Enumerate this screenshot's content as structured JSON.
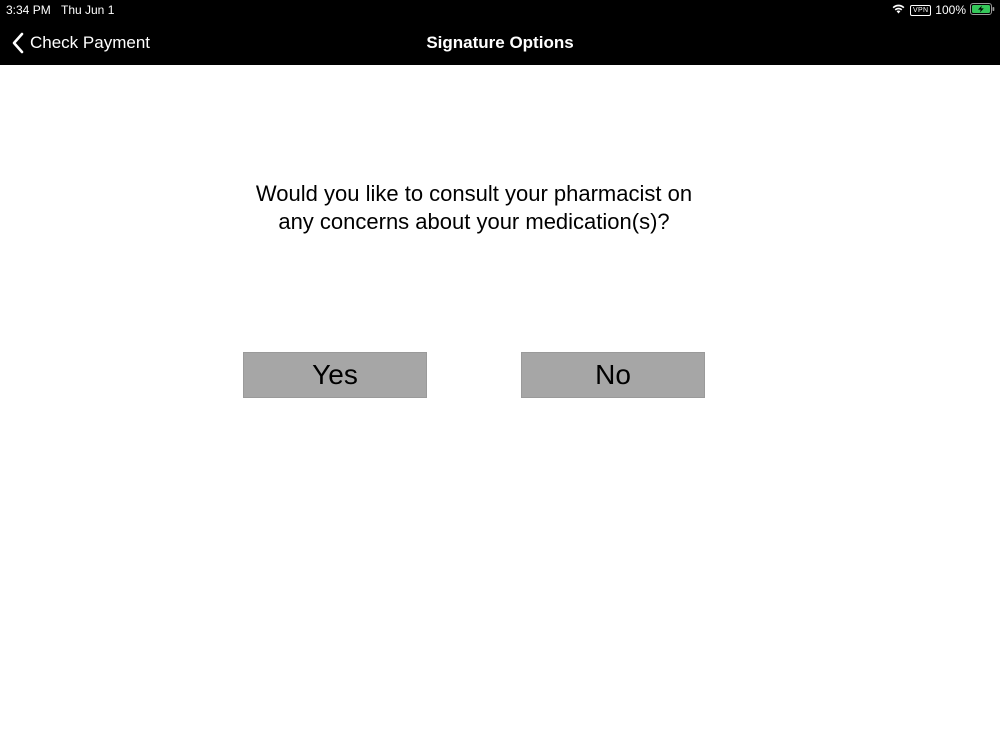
{
  "status_bar": {
    "time": "3:34 PM",
    "date": "Thu Jun 1",
    "vpn": "VPN",
    "battery": "100%"
  },
  "nav": {
    "back_label": "Check Payment",
    "title": "Signature Options"
  },
  "content": {
    "question_line1": "Would you like to consult your pharmacist on",
    "question_line2": "any concerns about your medication(s)?",
    "yes_label": "Yes",
    "no_label": "No"
  },
  "colors": {
    "bar_background": "#000000",
    "button_background": "#a6a6a6",
    "battery_fill": "#34c759"
  },
  "icons": [
    "wifi-icon",
    "battery-charging-icon",
    "chevron-left-icon"
  ]
}
